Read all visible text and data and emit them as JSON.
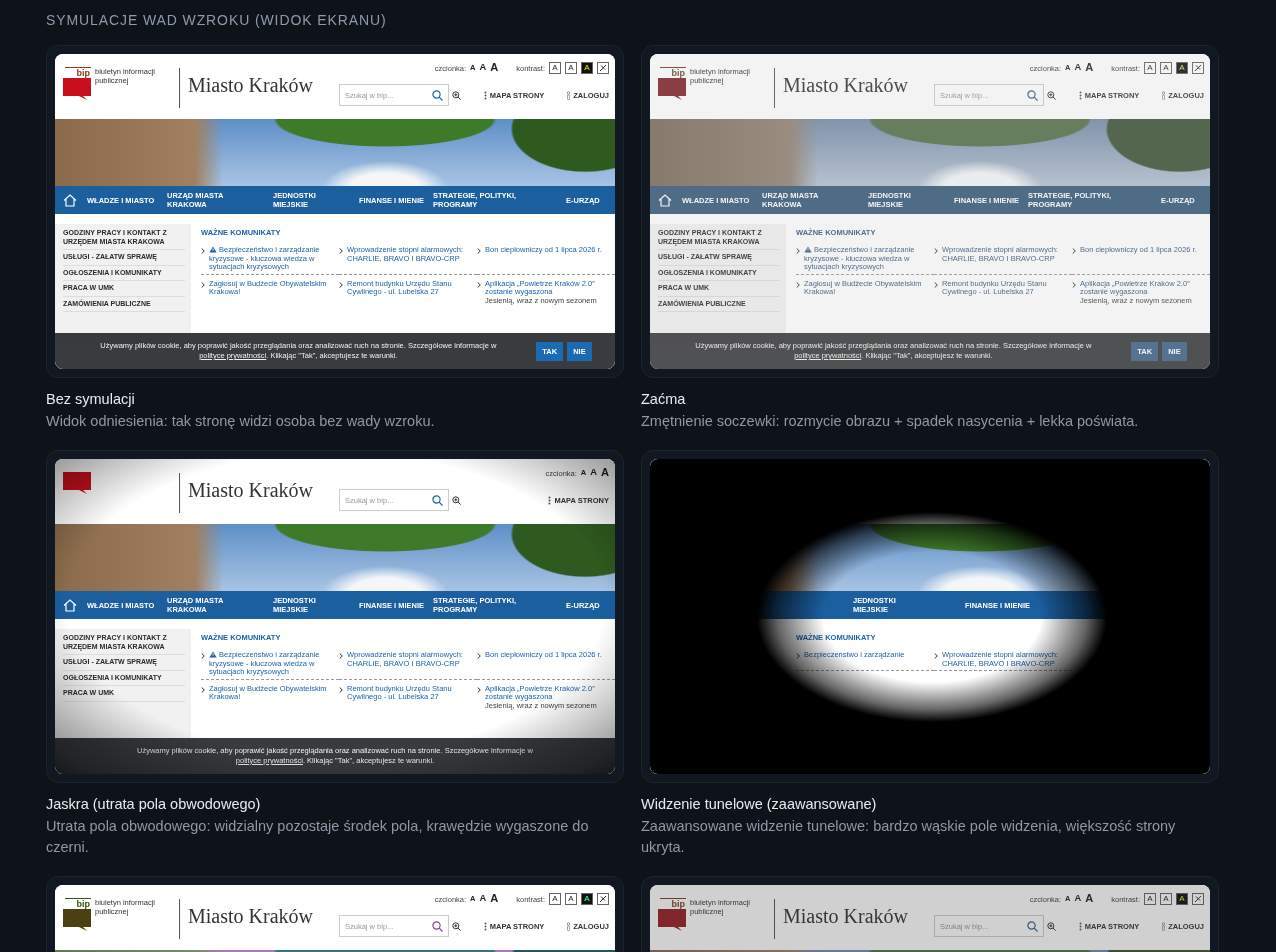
{
  "heading": "SYMULACJE WAD WZROKU (WIDOK EKRANU)",
  "cards": [
    {
      "kind": "normal",
      "title": "Bez symulacji",
      "description": "Widok odniesienia: tak stronę widzi osoba bez wady wzroku.",
      "preview": {
        "logo_mark": "bip",
        "logo_text": "biuletyn informacji publicznej",
        "font_label": "czcionka:",
        "font_sizes": [
          "A",
          "A",
          "A"
        ],
        "contrast_label": "kontrast:",
        "contrast_options": [
          "A",
          "A",
          "A"
        ],
        "title": "Miasto Kraków",
        "search_placeholder": "Szukaj w bip...",
        "links": [
          "MAPA STRONY",
          "ZALOGUJ"
        ],
        "nav": [
          "WŁADZE I MIASTO",
          "URZĄD MIASTA KRAKOWA",
          "JEDNOSTKI MIEJSKIE",
          "FINANSE I MIENIE",
          "STRATEGIE, POLITYKI, PROGRAMY",
          "E-URZĄD"
        ],
        "sidebar": [
          "GODZINY PRACY I KONTAKT Z URZĘDEM MIASTA KRAKOWA",
          "USŁUGI - ZAŁATW SPRAWĘ",
          "OGŁOSZENIA I KOMUNIKATY",
          "PRACA W UMK",
          "ZAMÓWIENIA PUBLICZNE"
        ],
        "section_title": "WAŻNE KOMUNIKATY",
        "news": [
          {
            "text": "Bezpieczeństwo i zarządzanie kryzysowe - kluczowa wiedza w sytuacjach kryzysowych",
            "alert": true
          },
          {
            "text": "Wprowadzenie stopni alarmowych: CHARLIE, BRAVO I BRAVO-CRP",
            "alert": false
          },
          {
            "text": "Bon ciepłowniczy od 1 lipca 2026 r.",
            "alert": false
          },
          {
            "text": "Zagłosuj w Budżecie Obywatelskim Krakowa!",
            "alert": false
          },
          {
            "text": "Remont budynku Urzędu Stanu Cywilnego - ul. Lubelska 27",
            "alert": false
          },
          {
            "text": "Aplikacja „Powietrze Kraków 2.0” zostanie wygaszona",
            "alert": false,
            "excerpt": "Jesienią, wraz z nowym sezonem"
          }
        ],
        "cookie": {
          "text": "Używamy plików cookie, aby poprawić jakość przeglądania oraz analizować ruch na stronie. Szczegółowe informacje w",
          "link": "polityce prywatności",
          "after": ". Klikając \"Tak\", akceptujesz te warunki.",
          "buttons": [
            "TAK",
            "NIE"
          ]
        }
      }
    },
    {
      "kind": "cataract",
      "title": "Zaćma",
      "description": "Zmętnienie soczewki: rozmycie obrazu + spadek nasycenia + lekka poświata.",
      "preview": {
        "logo_mark": "bip",
        "logo_text": "biuletyn informacji publicznej",
        "font_label": "czcionka:",
        "font_sizes": [
          "A",
          "A",
          "A"
        ],
        "contrast_label": "kontrast:",
        "contrast_options": [
          "A",
          "A",
          "A"
        ],
        "title": "Miasto Kraków",
        "search_placeholder": "Szukaj w bip...",
        "links": [
          "MAPA STRONY",
          "ZALOGUJ"
        ],
        "nav": [
          "WŁADZE I MIASTO",
          "URZĄD MIASTA KRAKOWA",
          "JEDNOSTKI MIEJSKIE",
          "FINANSE I MIENIE",
          "STRATEGIE, POLITYKI, PROGRAMY",
          "E-URZĄD"
        ],
        "sidebar": [
          "GODZINY PRACY I KONTAKT Z URZĘDEM MIASTA KRAKOWA",
          "USŁUGI - ZAŁATW SPRAWĘ",
          "OGŁOSZENIA I KOMUNIKATY",
          "PRACA W UMK",
          "ZAMÓWIENIA PUBLICZNE"
        ],
        "section_title": "WAŻNE KOMUNIKATY",
        "news": [
          {
            "text": "Bezpieczeństwo i zarządzanie kryzysowe - kluczowa wiedza w sytuacjach kryzysowych",
            "alert": true
          },
          {
            "text": "Wprowadzenie stopni alarmowych: CHARLIE, BRAVO I BRAVO-CRP",
            "alert": false
          },
          {
            "text": "Bon ciepłowniczy od 1 lipca 2026 r.",
            "alert": false
          },
          {
            "text": "Zagłosuj w Budżecie Obywatelskim Krakowa!",
            "alert": false
          },
          {
            "text": "Remont budynku Urzędu Stanu Cywilnego - ul. Lubelska 27",
            "alert": false
          },
          {
            "text": "Aplikacja „Powietrze Kraków 2.0” zostanie wygaszona",
            "alert": false,
            "excerpt": "Jesienią, wraz z nowym sezonem"
          }
        ],
        "cookie": {
          "text": "Używamy plików cookie, aby poprawić jakość przeglądania oraz analizować ruch na stronie. Szczegółowe informacje w",
          "link": "polityce prywatności",
          "after": ". Klikając \"Tak\", akceptujesz te warunki.",
          "buttons": [
            "TAK",
            "NIE"
          ]
        }
      }
    },
    {
      "kind": "glaucoma",
      "title": "Jaskra (utrata pola obwodowego)",
      "description": "Utrata pola obwodowego: widzialny pozostaje środek pola, krawędzie wygaszone do czerni.",
      "preview": {
        "font_label": "czcionka:",
        "font_sizes": [
          "A",
          "A",
          "A"
        ],
        "title": "Miasto Kraków",
        "search_placeholder": "Szukaj w bip...",
        "links": [
          "MAPA STRONY"
        ],
        "nav": [
          "WŁADZE I MIASTO",
          "URZĄD MIASTA KRAKOWA",
          "JEDNOSTKI MIEJSKIE",
          "FINANSE I MIENIE",
          "STRATEGIE, POLITYKI, PROGRAMY",
          "E-URZĄD"
        ],
        "sidebar": [
          "GODZINY PRACY I KONTAKT Z URZĘDEM MIASTA KRAKOWA",
          "USŁUGI - ZAŁATW SPRAWĘ",
          "OGŁOSZENIA I KOMUNIKATY",
          "PRACA W UMK"
        ],
        "section_title": "WAŻNE KOMUNIKATY",
        "news": [
          {
            "text": "Bezpieczeństwo i zarządzanie kryzysowe - kluczowa wiedza w sytuacjach kryzysowych",
            "alert": true
          },
          {
            "text": "Wprowadzenie stopni alarmowych: CHARLIE, BRAVO I BRAVO-CRP",
            "alert": false
          },
          {
            "text": "Bon ciepłowniczy od 1 lipca 2026 r.",
            "alert": false
          },
          {
            "text": "Zagłosuj w Budżecie Obywatelskim Krakowa!",
            "alert": false
          },
          {
            "text": "Remont budynku Urzędu Stanu Cywilnego - ul. Lubelska 27",
            "alert": false
          },
          {
            "text": "Aplikacja „Powietrze Kraków 2.0” zostanie wygaszona",
            "alert": false,
            "excerpt": "Jesienią, wraz z nowym sezonem"
          }
        ],
        "cookie": {
          "text": "Używamy plików cookie, aby poprawić jakość przeglądania oraz analizować ruch na stronie. Szczegółowe informacje w",
          "link": "polityce prywatności",
          "after": ". Klikając \"Tak\", akceptujesz te warunki."
        }
      }
    },
    {
      "kind": "tunnel",
      "title": "Widzenie tunelowe (zaawansowane)",
      "description": "Zaawansowane widzenie tunelowe: bardzo wąskie pole widzenia, większość strony ukryta.",
      "preview": {
        "nav": [
          "JEDNOSTKI MIEJSKIE",
          "FINANSE I MIENIE"
        ],
        "section_title": "WAŻNE KOMUNIKATY",
        "news": [
          {
            "text": "Bezpieczeństwo i zarządzanie",
            "alert": false
          },
          {
            "text": "Wprowadzenie stopni alarmowych: CHARLIE, BRAVO I BRAVO-CRP",
            "alert": false
          }
        ]
      }
    },
    {
      "kind": "deutan",
      "preview": {
        "logo_mark": "bip",
        "logo_text": "biuletyn informacji publicznej",
        "font_label": "czcionka:",
        "font_sizes": [
          "A",
          "A",
          "A"
        ],
        "contrast_label": "kontrast:",
        "contrast_options": [
          "A",
          "A",
          "A"
        ],
        "title": "Miasto Kraków",
        "search_placeholder": "Szukaj w bip...",
        "links": [
          "MAPA STRONY",
          "ZALOGUJ"
        ]
      }
    },
    {
      "kind": "lowcontrast",
      "preview": {
        "logo_mark": "bip",
        "logo_text": "biuletyn informacji publicznej",
        "font_label": "czcionka:",
        "font_sizes": [
          "A",
          "A",
          "A"
        ],
        "contrast_label": "kontrast:",
        "contrast_options": [
          "A",
          "A",
          "A"
        ],
        "title": "Miasto Kraków",
        "search_placeholder": "Szukaj w bip...",
        "links": [
          "MAPA STRONY",
          "ZALOGUJ"
        ]
      }
    }
  ]
}
